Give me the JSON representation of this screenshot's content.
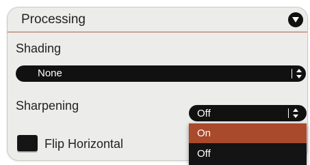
{
  "panel": {
    "title": "Processing",
    "toggle_icon": "chevron-down-icon"
  },
  "shading": {
    "label": "Shading",
    "value": "None"
  },
  "sharpening": {
    "label": "Sharpening",
    "value": "Off",
    "options": [
      {
        "label": "On",
        "highlighted": true
      },
      {
        "label": "Off",
        "highlighted": false
      }
    ]
  },
  "flip": {
    "label": "Flip Horizontal",
    "checked": false
  },
  "colors": {
    "panel_bg": "#ececea",
    "control_bg": "#111111",
    "highlight": "#a94a2c",
    "header_rule": "#c9a293"
  }
}
